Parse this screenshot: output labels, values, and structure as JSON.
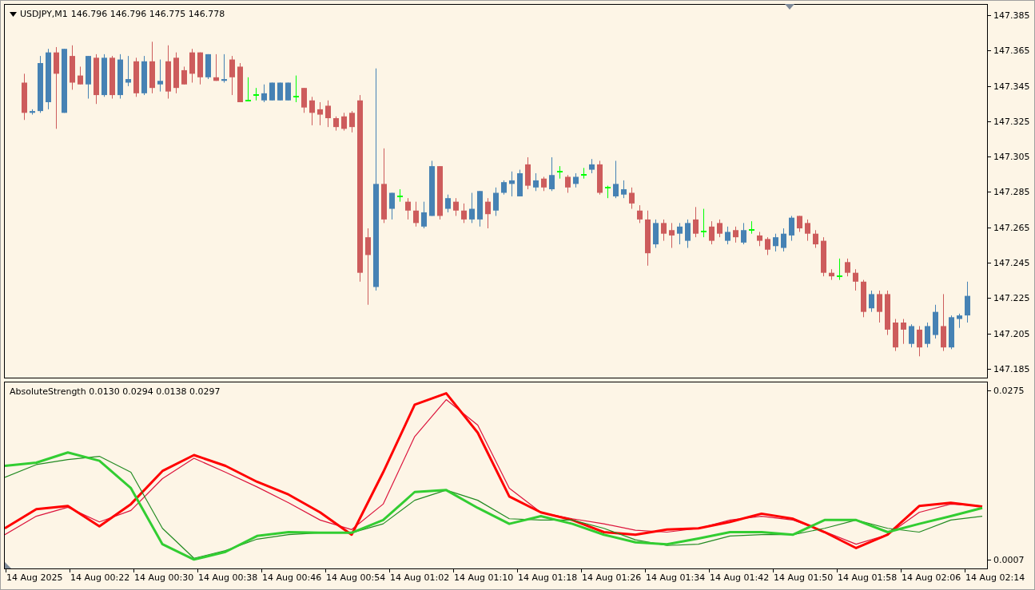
{
  "price_panel": {
    "title": "USDJPY,M1",
    "quote": "146.796 146.796 146.775 146.778",
    "chart_data": {
      "type": "candlestick",
      "ylim": [
        147.181,
        147.3908
      ],
      "yticks": [
        {
          "value": 147.385,
          "label": "147.385"
        },
        {
          "value": 147.365,
          "label": "147.365"
        },
        {
          "value": 147.345,
          "label": "147.345"
        },
        {
          "value": 147.325,
          "label": "147.325"
        },
        {
          "value": 147.305,
          "label": "147.305"
        },
        {
          "value": 147.285,
          "label": "147.285"
        },
        {
          "value": 147.265,
          "label": "147.265"
        },
        {
          "value": 147.245,
          "label": "147.245"
        },
        {
          "value": 147.225,
          "label": "147.225"
        },
        {
          "value": 147.205,
          "label": "147.205"
        },
        {
          "value": 147.185,
          "label": "147.185"
        }
      ],
      "categories": [
        null,
        null,
        null,
        null,
        null,
        null,
        null,
        null,
        null,
        null,
        null,
        null,
        null,
        null,
        null,
        null,
        null,
        null,
        null,
        null,
        null,
        null,
        null,
        null,
        null,
        null,
        null,
        null,
        null,
        null,
        null,
        null,
        null,
        null,
        null,
        null,
        null,
        null,
        null,
        null,
        null,
        null,
        null,
        null,
        null,
        null,
        null,
        null,
        null,
        null,
        null,
        null,
        null,
        null,
        null,
        null,
        null,
        null,
        null,
        null,
        null,
        null,
        null,
        null,
        null,
        null,
        null,
        null,
        null,
        null,
        null,
        null,
        null,
        null,
        null,
        null,
        null,
        null,
        null,
        null,
        null,
        null,
        null,
        null,
        null,
        null,
        null,
        null,
        null,
        null,
        null,
        null,
        null,
        null,
        null,
        null,
        null,
        null,
        null,
        null,
        null,
        null,
        null,
        null,
        null,
        null,
        null,
        null,
        null,
        null,
        null,
        null,
        null,
        null,
        null,
        null,
        null,
        null,
        null
      ],
      "ohlc": [
        [
          147.347,
          147.352,
          147.326,
          147.33
        ],
        [
          147.33,
          147.332,
          147.329,
          147.331
        ],
        [
          147.331,
          147.362,
          147.33,
          147.358
        ],
        [
          147.336,
          147.366,
          147.332,
          147.364
        ],
        [
          147.364,
          147.367,
          147.321,
          147.352
        ],
        [
          147.33,
          147.366,
          147.33,
          147.366
        ],
        [
          147.362,
          147.368,
          147.343,
          147.347
        ],
        [
          147.351,
          147.356,
          147.346,
          147.346
        ],
        [
          147.346,
          147.362,
          147.338,
          147.362
        ],
        [
          147.361,
          147.363,
          147.335,
          147.34
        ],
        [
          147.34,
          147.363,
          147.339,
          147.361
        ],
        [
          147.361,
          147.362,
          147.338,
          147.34
        ],
        [
          147.34,
          147.363,
          147.338,
          147.36
        ],
        [
          147.347,
          147.362,
          147.345,
          147.349
        ],
        [
          147.359,
          147.361,
          147.339,
          147.341
        ],
        [
          147.341,
          147.362,
          147.34,
          147.359
        ],
        [
          147.359,
          147.37,
          147.341,
          147.344
        ],
        [
          147.346,
          147.36,
          147.342,
          147.348
        ],
        [
          147.359,
          147.368,
          147.338,
          147.342
        ],
        [
          147.361,
          147.364,
          147.341,
          147.344
        ],
        [
          147.354,
          147.356,
          147.346,
          147.346
        ],
        [
          147.364,
          147.366,
          147.347,
          147.352
        ],
        [
          147.364,
          147.364,
          147.346,
          147.35
        ],
        [
          147.35,
          147.363,
          147.349,
          147.363
        ],
        [
          147.35,
          147.363,
          147.348,
          147.348
        ],
        [
          147.348,
          147.363,
          147.347,
          147.349
        ],
        [
          147.36,
          147.362,
          147.34,
          147.35
        ],
        [
          147.356,
          147.358,
          147.336,
          147.336
        ],
        [
          147.337,
          147.35,
          147.337,
          147.337
        ],
        [
          147.34,
          147.344,
          147.337,
          147.34
        ],
        [
          147.337,
          147.346,
          147.336,
          147.341
        ],
        [
          147.337,
          147.347,
          147.337,
          147.347
        ],
        [
          147.337,
          147.347,
          147.337,
          147.347
        ],
        [
          147.337,
          147.347,
          147.337,
          147.347
        ],
        [
          147.339,
          147.351,
          147.336,
          147.339
        ],
        [
          147.344,
          147.344,
          147.33,
          147.333
        ],
        [
          147.337,
          147.339,
          147.323,
          147.33
        ],
        [
          147.332,
          147.336,
          147.323,
          147.329
        ],
        [
          147.334,
          147.337,
          147.322,
          147.327
        ],
        [
          147.327,
          147.328,
          147.32,
          147.322
        ],
        [
          147.328,
          147.33,
          147.32,
          147.321
        ],
        [
          147.33,
          147.331,
          147.319,
          147.322
        ],
        [
          147.337,
          147.34,
          147.235,
          147.24
        ],
        [
          147.26,
          147.265,
          147.222,
          147.25
        ],
        [
          147.232,
          147.355,
          147.23,
          147.29
        ],
        [
          147.29,
          147.31,
          147.268,
          147.27
        ],
        [
          147.276,
          147.285,
          147.27,
          147.285
        ],
        [
          147.283,
          147.287,
          147.28,
          147.283
        ],
        [
          147.28,
          147.282,
          147.27,
          147.275
        ],
        [
          147.275,
          147.28,
          147.266,
          147.268
        ],
        [
          147.266,
          147.28,
          147.265,
          147.274
        ],
        [
          147.272,
          147.303,
          147.272,
          147.3
        ],
        [
          147.3,
          147.3,
          147.27,
          147.272
        ],
        [
          147.276,
          147.284,
          147.274,
          147.282
        ],
        [
          147.28,
          147.282,
          147.272,
          147.275
        ],
        [
          147.275,
          147.279,
          147.268,
          147.27
        ],
        [
          147.27,
          147.285,
          147.268,
          147.276
        ],
        [
          147.27,
          147.286,
          147.266,
          147.286
        ],
        [
          147.28,
          147.282,
          147.265,
          147.273
        ],
        [
          147.275,
          147.288,
          147.272,
          147.285
        ],
        [
          147.285,
          147.292,
          147.284,
          147.291
        ],
        [
          147.29,
          147.297,
          147.283,
          147.292
        ],
        [
          147.283,
          147.298,
          147.283,
          147.296
        ],
        [
          147.301,
          147.305,
          147.287,
          147.289
        ],
        [
          147.288,
          147.296,
          147.286,
          147.292
        ],
        [
          147.293,
          147.294,
          147.286,
          147.288
        ],
        [
          147.287,
          147.305,
          147.286,
          147.295
        ],
        [
          147.297,
          147.3,
          147.293,
          147.297
        ],
        [
          147.294,
          147.295,
          147.285,
          147.288
        ],
        [
          147.29,
          147.296,
          147.288,
          147.294
        ],
        [
          147.295,
          147.299,
          147.293,
          147.295
        ],
        [
          147.298,
          147.304,
          147.296,
          147.301
        ],
        [
          147.301,
          147.303,
          147.284,
          147.285
        ],
        [
          147.288,
          147.289,
          147.282,
          147.288
        ],
        [
          147.283,
          147.303,
          147.282,
          147.29
        ],
        [
          147.284,
          147.292,
          147.282,
          147.287
        ],
        [
          147.285,
          147.288,
          147.276,
          147.279
        ],
        [
          147.275,
          147.278,
          147.268,
          147.27
        ],
        [
          147.27,
          147.275,
          147.244,
          147.251
        ],
        [
          147.256,
          147.27,
          147.254,
          147.268
        ],
        [
          147.268,
          147.27,
          147.258,
          147.262
        ],
        [
          147.264,
          147.268,
          147.254,
          147.261
        ],
        [
          147.262,
          147.268,
          147.256,
          147.266
        ],
        [
          147.258,
          147.27,
          147.254,
          147.268
        ],
        [
          147.27,
          147.277,
          147.26,
          147.262
        ],
        [
          147.263,
          147.276,
          147.26,
          147.263
        ],
        [
          147.266,
          147.269,
          147.256,
          147.258
        ],
        [
          147.268,
          147.27,
          147.26,
          147.262
        ],
        [
          147.258,
          147.266,
          147.256,
          147.263
        ],
        [
          147.264,
          147.266,
          147.257,
          147.26
        ],
        [
          147.257,
          147.268,
          147.256,
          147.264
        ],
        [
          147.264,
          147.269,
          147.262,
          147.264
        ],
        [
          147.261,
          147.263,
          147.255,
          147.258
        ],
        [
          147.259,
          147.26,
          147.25,
          147.253
        ],
        [
          147.255,
          147.262,
          147.252,
          147.26
        ],
        [
          147.254,
          147.265,
          147.252,
          147.262
        ],
        [
          147.261,
          147.272,
          147.258,
          147.271
        ],
        [
          147.272,
          147.272,
          147.263,
          147.265
        ],
        [
          147.268,
          147.27,
          147.258,
          147.262
        ],
        [
          147.262,
          147.264,
          147.254,
          147.256
        ],
        [
          147.258,
          147.26,
          147.238,
          147.24
        ],
        [
          147.24,
          147.242,
          147.236,
          147.238
        ],
        [
          147.238,
          147.248,
          147.236,
          147.238
        ],
        [
          147.246,
          147.248,
          147.238,
          147.24
        ],
        [
          147.24,
          147.242,
          147.23,
          147.235
        ],
        [
          147.235,
          147.236,
          147.215,
          147.218
        ],
        [
          147.22,
          147.23,
          147.218,
          147.228
        ],
        [
          147.228,
          147.23,
          147.212,
          147.218
        ],
        [
          147.228,
          147.23,
          147.205,
          147.208
        ],
        [
          147.212,
          147.214,
          147.196,
          147.198
        ],
        [
          147.212,
          147.214,
          147.2,
          147.208
        ],
        [
          147.2,
          147.211,
          147.198,
          147.21
        ],
        [
          147.208,
          147.21,
          147.193,
          147.198
        ],
        [
          147.2,
          147.212,
          147.198,
          147.21
        ],
        [
          147.205,
          147.222,
          147.203,
          147.218
        ],
        [
          147.21,
          147.228,
          147.196,
          147.198
        ],
        [
          147.198,
          147.216,
          147.197,
          147.215
        ],
        [
          147.214,
          147.217,
          147.209,
          147.216
        ],
        [
          147.216,
          147.235,
          147.212,
          147.227
        ]
      ]
    }
  },
  "indicator_panel": {
    "title": "AbsoluteStrength 0.0130 0.0294 0.0138 0.0297",
    "chart_data": {
      "type": "line",
      "ylim": [
        -0.0004,
        0.0288
      ],
      "yticks": [
        {
          "value": 0.0275,
          "label": "0.0275"
        },
        {
          "value": 0.0007,
          "label": "0.0007"
        }
      ],
      "series": [
        {
          "color": "#dc143c",
          "values": [
            0.0049,
            0.0078,
            0.0092,
            0.0069,
            0.0087,
            0.0137,
            0.0169,
            0.0147,
            0.0124,
            0.0099,
            0.0072,
            0.0057,
            0.0097,
            0.0203,
            0.0261,
            0.0221,
            0.0122,
            0.0084,
            0.0074,
            0.0066,
            0.0056,
            0.0053,
            0.0059,
            0.0072,
            0.0078,
            0.0072,
            0.0054,
            0.0034,
            0.0049,
            0.0084,
            0.0097,
            0.0094
          ]
        },
        {
          "color": "#ff0000",
          "values": [
            0.0059,
            0.0089,
            0.0094,
            0.0062,
            0.0097,
            0.0149,
            0.0174,
            0.0157,
            0.0132,
            0.0112,
            0.0084,
            0.0049,
            0.0147,
            0.0253,
            0.0271,
            0.0209,
            0.0109,
            0.0084,
            0.0072,
            0.0053,
            0.0049,
            0.0057,
            0.0059,
            0.0069,
            0.0082,
            0.0074,
            0.0053,
            0.0028,
            0.0049,
            0.0094,
            0.0099,
            0.0093
          ]
        },
        {
          "color": "#228b22",
          "values": [
            0.0139,
            0.0159,
            0.0167,
            0.0172,
            0.0147,
            0.0059,
            0.0012,
            0.0024,
            0.0042,
            0.0049,
            0.0052,
            0.0052,
            0.0066,
            0.0103,
            0.0119,
            0.0103,
            0.0074,
            0.0072,
            0.0072,
            0.0059,
            0.0041,
            0.0032,
            0.0034,
            0.0047,
            0.0049,
            0.0049,
            0.0059,
            0.0072,
            0.0059,
            0.0053,
            0.0072,
            0.0078
          ]
        },
        {
          "color": "#32cd32",
          "values": [
            0.0157,
            0.0162,
            0.0178,
            0.0165,
            0.0122,
            0.0034,
            0.001,
            0.0022,
            0.0047,
            0.0053,
            0.0052,
            0.0052,
            0.0072,
            0.0116,
            0.0119,
            0.0091,
            0.0066,
            0.0078,
            0.0066,
            0.0049,
            0.0037,
            0.0034,
            0.0043,
            0.0053,
            0.0053,
            0.0049,
            0.0072,
            0.0072,
            0.0053,
            0.0066,
            0.0078,
            0.0091
          ]
        }
      ]
    }
  },
  "time_axis": [
    "14 Aug 2025",
    "14 Aug 00:22",
    "14 Aug 00:30",
    "14 Aug 00:38",
    "14 Aug 00:46",
    "14 Aug 00:54",
    "14 Aug 01:02",
    "14 Aug 01:10",
    "14 Aug 01:18",
    "14 Aug 01:26",
    "14 Aug 01:34",
    "14 Aug 01:42",
    "14 Aug 01:50",
    "14 Aug 01:58",
    "14 Aug 02:06",
    "14 Aug 02:14"
  ]
}
